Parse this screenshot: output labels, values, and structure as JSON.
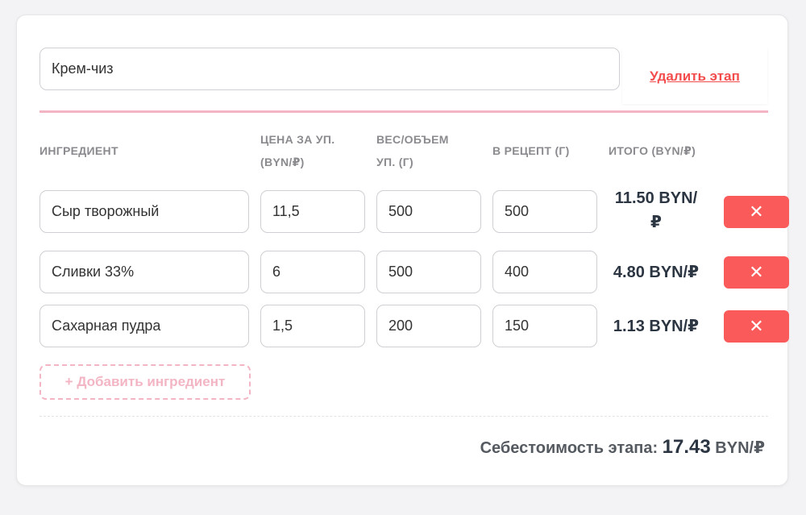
{
  "stage": {
    "name": "Крем-чиз",
    "delete_label": "Удалить этап"
  },
  "table": {
    "headers": {
      "ingredient": "ИНГРЕДИЕНТ",
      "price_line1": "ЦЕНА ЗА УП.",
      "price_line2": "(BYN/₽)",
      "weight_line1": "ВЕС/ОБЪЕМ",
      "weight_line2": "УП. (Г)",
      "in_recipe": "В РЕЦЕПТ (Г)",
      "total": "ИТОГО (BYN/₽)"
    },
    "rows": [
      {
        "ingredient": "Сыр творожный",
        "price": "11,5",
        "weight": "500",
        "in_recipe": "500",
        "total_line1": "11.50 BYN/",
        "total_line2": "₽"
      },
      {
        "ingredient": "Сливки 33%",
        "price": "6",
        "weight": "500",
        "in_recipe": "400",
        "total_line1": "4.80 BYN/₽",
        "total_line2": ""
      },
      {
        "ingredient": "Сахарная пудра",
        "price": "1,5",
        "weight": "200",
        "in_recipe": "150",
        "total_line1": "1.13 BYN/₽",
        "total_line2": ""
      }
    ],
    "remove_icon": "✕"
  },
  "add_ingredient_label": "+ Добавить ингредиент",
  "stage_cost": {
    "label": "Себестоимость этапа:",
    "value": "17.43",
    "unit": "BYN/₽"
  },
  "colors": {
    "accent_pink": "#f3b5c4",
    "danger_red": "#fb5a5a",
    "link_red": "#f24c4c"
  }
}
